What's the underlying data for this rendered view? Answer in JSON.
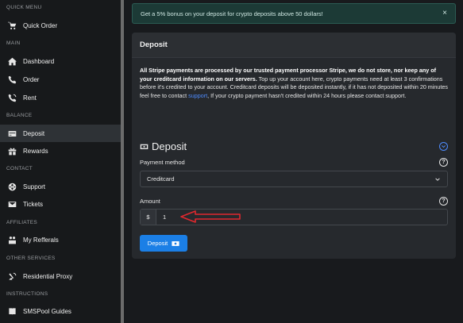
{
  "sidebar": {
    "sections": {
      "quick_menu": "QUICK MENU",
      "main": "MAIN",
      "balance": "BALANCE",
      "contact": "CONTACT",
      "affiliates": "AFFILIATES",
      "other_services": "OTHER SERVICES",
      "instructions": "INSTRUCTIONS"
    },
    "items": [
      {
        "label": "Quick Order",
        "icon": "cart-icon"
      },
      {
        "label": "Dashboard",
        "icon": "home-icon"
      },
      {
        "label": "Order",
        "icon": "phone-icon"
      },
      {
        "label": "Rent",
        "icon": "phone-rent-icon"
      },
      {
        "label": "Deposit",
        "icon": "credit-card-icon",
        "active": true
      },
      {
        "label": "Rewards",
        "icon": "gift-icon"
      },
      {
        "label": "Support",
        "icon": "globe-icon"
      },
      {
        "label": "Tickets",
        "icon": "envelope-icon"
      },
      {
        "label": "My Refferals",
        "icon": "users-icon"
      },
      {
        "label": "Residential Proxy",
        "icon": "satellite-icon"
      },
      {
        "label": "SMSPool Guides",
        "icon": "book-icon"
      }
    ]
  },
  "alert": {
    "text": "Get a 5% bonus on your deposit for crypto deposits above 50 dollars!",
    "close": "×"
  },
  "card": {
    "title": "Deposit",
    "info_bold": "All Stripe payments are processed by our trusted payment processor Stripe, we do not store, nor keep any of your creditcard information on our servers.",
    "info_text_1": " Top up your account here, crypto payments need at least 3 confirmations before it's credited to your account. Creditcard deposits will be deposited instantly, if it has not deposited within 20 minutes feel free to contact ",
    "info_link": "support",
    "info_text_2": ", If your crypto payment hasn't credited within 24 hours please contact support.",
    "deposit_heading": "Deposit",
    "payment_method_label": "Payment method",
    "payment_method_value": "Creditcard",
    "amount_label": "Amount",
    "currency_addon": "$",
    "amount_value": "1",
    "help_glyph": "?",
    "submit_label": "Deposit"
  },
  "colors": {
    "accent": "#1b7fe6",
    "alert_bg": "#1c3a36",
    "annotation_arrow": "#e0282e"
  }
}
